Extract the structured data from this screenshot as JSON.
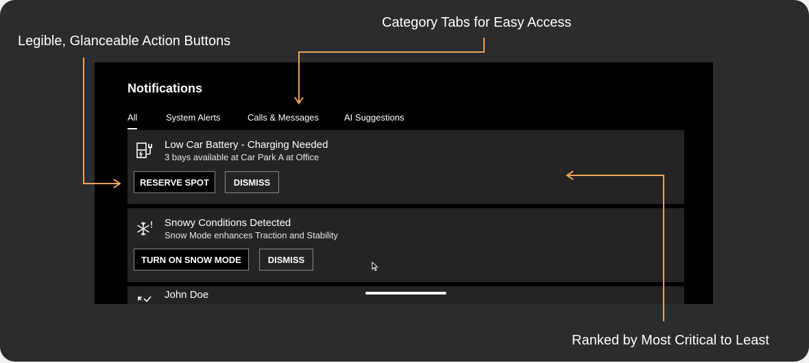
{
  "annotations": {
    "action_buttons": "Legible, Glanceable Action Buttons",
    "category_tabs": "Category Tabs for Easy Access",
    "ranking": "Ranked by Most Critical to Least"
  },
  "panel": {
    "title": "Notifications",
    "tabs": [
      {
        "label": "All",
        "active": true
      },
      {
        "label": "System Alerts",
        "active": false
      },
      {
        "label": "Calls & Messages",
        "active": false
      },
      {
        "label": "AI Suggestions",
        "active": false
      }
    ],
    "notifications": [
      {
        "icon": "ev-charging-icon",
        "title": "Low Car Battery - Charging Needed",
        "subtitle": "3 bays available at Car Park A at Office",
        "primary_action": "RESERVE SPOT",
        "secondary_action": "DISMISS"
      },
      {
        "icon": "snowflake-alert-icon",
        "title": "Snowy Conditions Detected",
        "subtitle": "Snow Mode enhances Traction and Stability",
        "primary_action": "TURN ON SNOW MODE",
        "secondary_action": "DISMISS"
      },
      {
        "icon": "missed-call-icon",
        "title": "John Doe"
      }
    ]
  },
  "colors": {
    "background": "#2b2c2e",
    "annotation_arrow": "#f0a35a",
    "screen": "#000000",
    "card": "#242424"
  }
}
